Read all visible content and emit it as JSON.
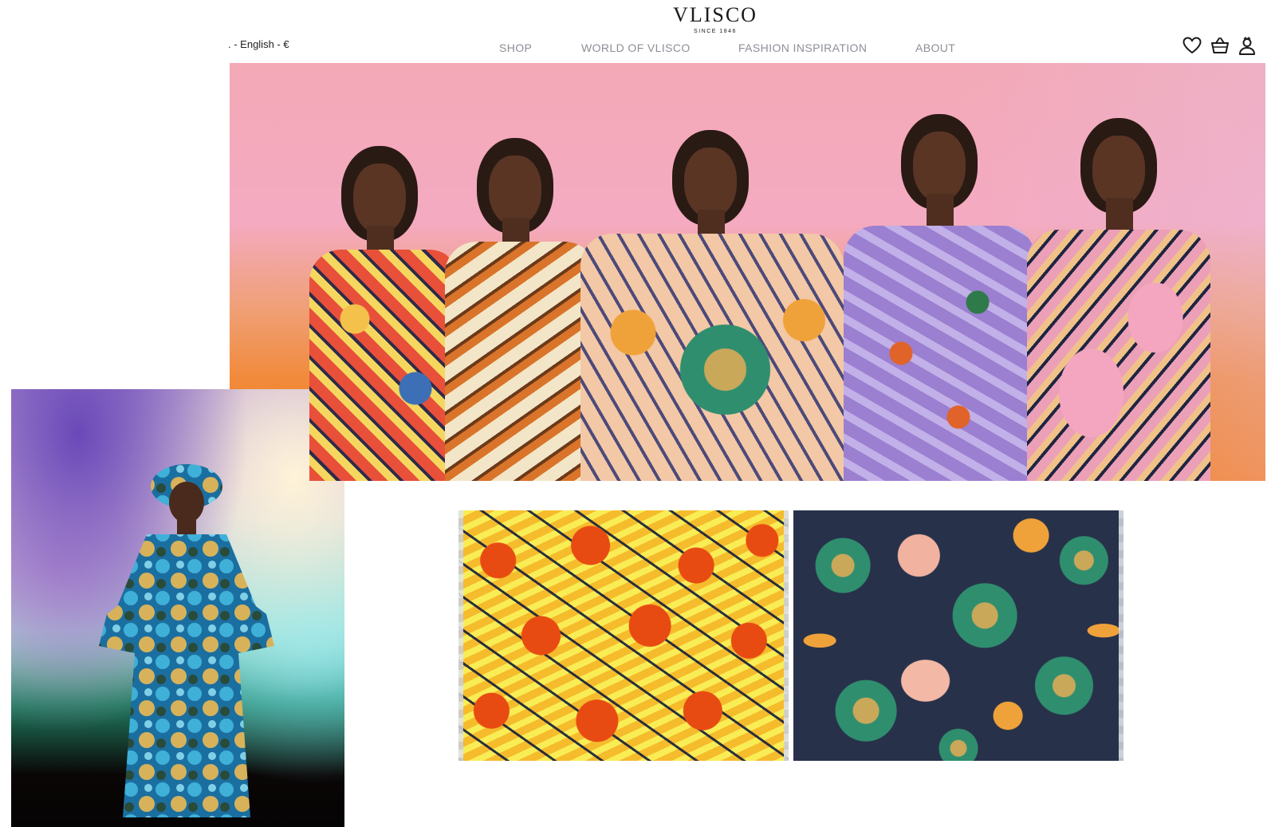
{
  "brand": {
    "name": "VLISCO",
    "tagline": "SINCE 1846"
  },
  "locale": {
    "label": ". - English - €"
  },
  "nav": {
    "items": [
      {
        "label": "SHOP"
      },
      {
        "label": "WORLD OF VLISCO"
      },
      {
        "label": "FASHION INSPIRATION"
      },
      {
        "label": "ABOUT"
      }
    ]
  },
  "header_icons": [
    "heart-icon",
    "basket-icon",
    "account-icon"
  ],
  "colors": {
    "nav_text": "#8b8f96",
    "hero_top": "#f3a9b6",
    "hero_bottom": "#f47d16"
  },
  "images": {
    "hero": "five-models-in-wax-print-dresses",
    "editorial": "model-in-blue-floral-gown",
    "fabric_left": "orange-yellow-bird-of-paradise-print",
    "fabric_right": "green-sunflower-print"
  }
}
